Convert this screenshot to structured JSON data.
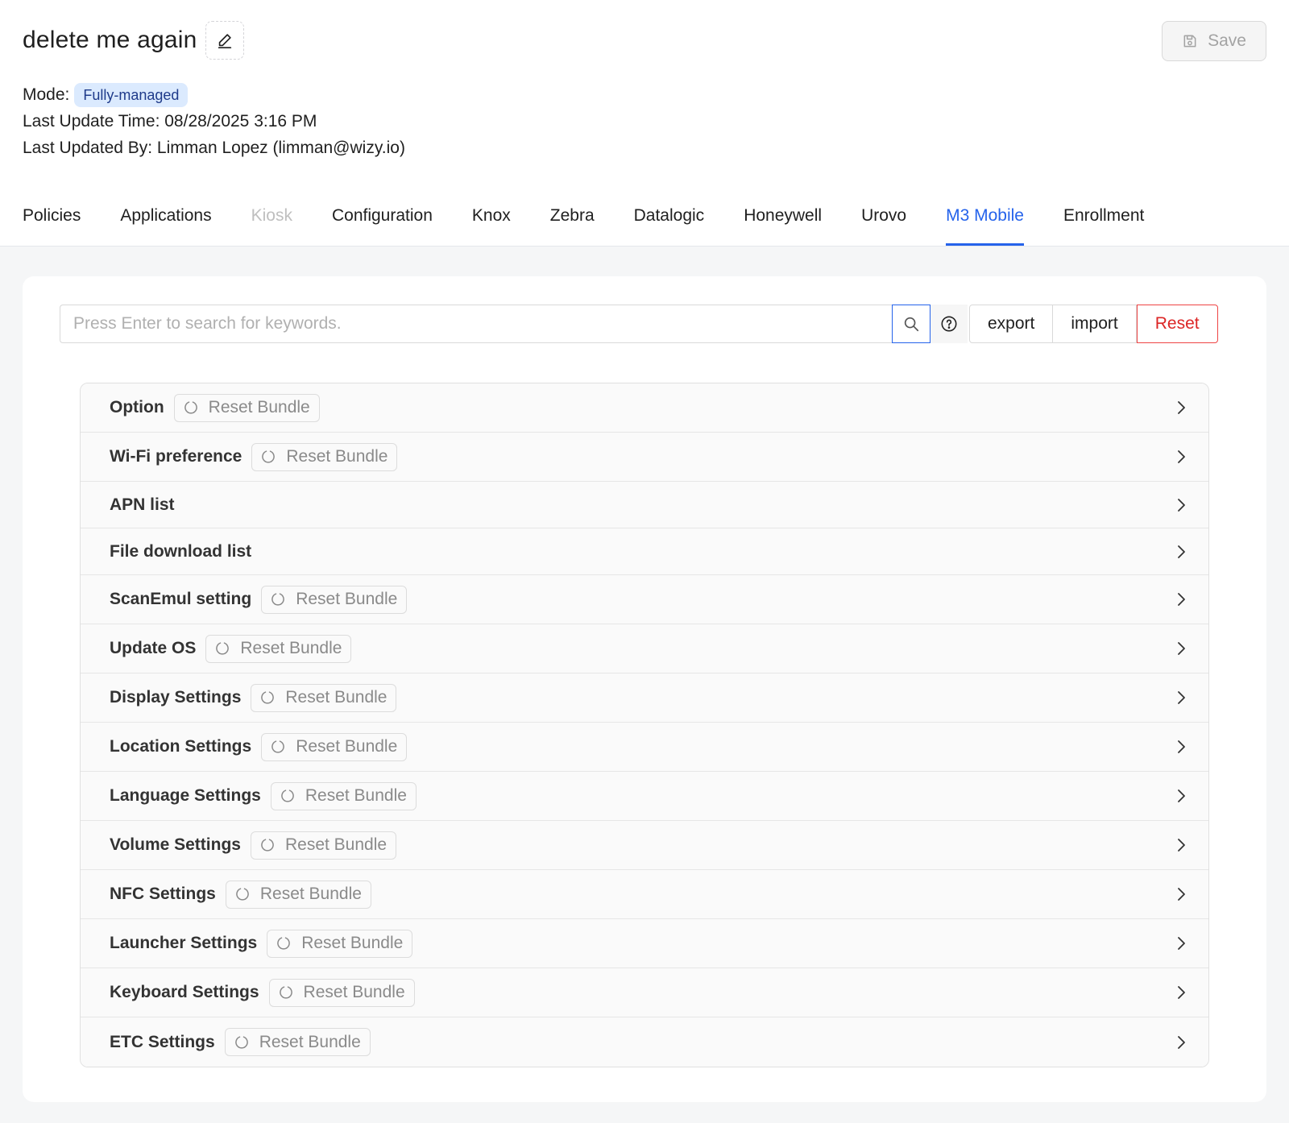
{
  "header": {
    "title": "delete me again",
    "save_label": "Save",
    "mode_label": "Mode:",
    "mode_value": "Fully-managed",
    "last_update_time": "Last Update Time: 08/28/2025 3:16 PM",
    "last_updated_by": "Last Updated By: Limman Lopez (limman@wizy.io)"
  },
  "tabs": [
    {
      "label": "Policies",
      "state": "normal"
    },
    {
      "label": "Applications",
      "state": "normal"
    },
    {
      "label": "Kiosk",
      "state": "disabled"
    },
    {
      "label": "Configuration",
      "state": "normal"
    },
    {
      "label": "Knox",
      "state": "normal"
    },
    {
      "label": "Zebra",
      "state": "normal"
    },
    {
      "label": "Datalogic",
      "state": "normal"
    },
    {
      "label": "Honeywell",
      "state": "normal"
    },
    {
      "label": "Urovo",
      "state": "normal"
    },
    {
      "label": "M3 Mobile",
      "state": "active"
    },
    {
      "label": "Enrollment",
      "state": "normal"
    }
  ],
  "toolbar": {
    "search_placeholder": "Press Enter to search for keywords.",
    "search_value": "",
    "export_label": "export",
    "import_label": "import",
    "reset_label": "Reset"
  },
  "reset_bundle_label": "Reset Bundle",
  "sections": [
    {
      "title": "Option",
      "has_reset": true
    },
    {
      "title": "Wi-Fi preference",
      "has_reset": true
    },
    {
      "title": "APN list",
      "has_reset": false
    },
    {
      "title": "File download list",
      "has_reset": false
    },
    {
      "title": "ScanEmul setting",
      "has_reset": true
    },
    {
      "title": "Update OS",
      "has_reset": true
    },
    {
      "title": "Display Settings",
      "has_reset": true
    },
    {
      "title": "Location Settings",
      "has_reset": true
    },
    {
      "title": "Language Settings",
      "has_reset": true
    },
    {
      "title": "Volume Settings",
      "has_reset": true
    },
    {
      "title": "NFC Settings",
      "has_reset": true
    },
    {
      "title": "Launcher Settings",
      "has_reset": true
    },
    {
      "title": "Keyboard Settings",
      "has_reset": true
    },
    {
      "title": "ETC Settings",
      "has_reset": true
    }
  ],
  "colors": {
    "accent": "#2563eb",
    "danger": "#dc2626",
    "badge_bg": "#dbeafe"
  }
}
